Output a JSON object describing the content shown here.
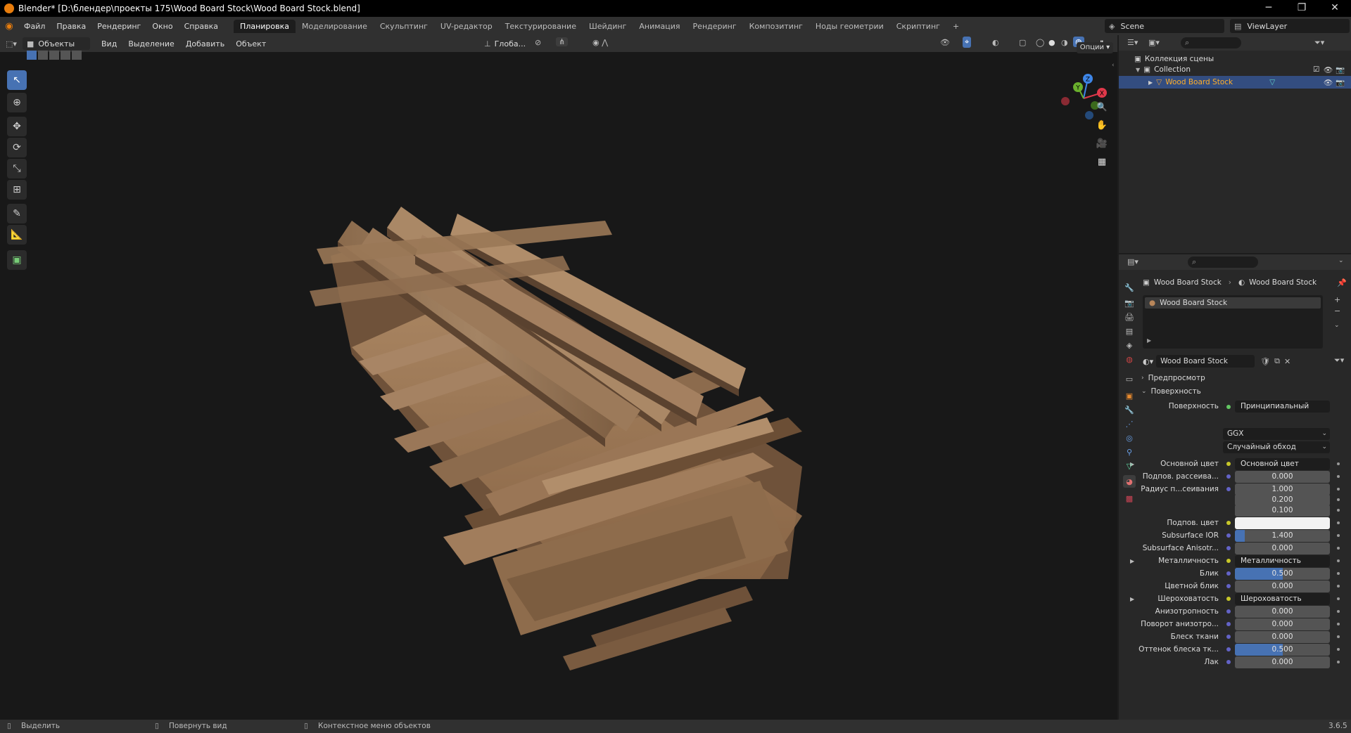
{
  "window": {
    "title": "Blender* [D:\\блендер\\проекты 175\\Wood Board Stock\\Wood Board Stock.blend]",
    "minimize": "─",
    "maximize": "❐",
    "close": "✕"
  },
  "menu": [
    "Файл",
    "Правка",
    "Рендеринг",
    "Окно",
    "Справка"
  ],
  "workspaces": [
    "Планировка",
    "Моделирование",
    "Скульптинг",
    "UV-редактор",
    "Текстурирование",
    "Шейдинг",
    "Анимация",
    "Рендеринг",
    "Композитинг",
    "Ноды геометрии",
    "Скриптинг",
    "+"
  ],
  "scene": {
    "name": "Scene",
    "view_layer": "ViewLayer"
  },
  "viewport_header": {
    "mode": "Объекты",
    "menus": [
      "Вид",
      "Выделение",
      "Добавить",
      "Объект"
    ],
    "orientation": "Глоба...",
    "options": "Опции"
  },
  "gizmo": {
    "x": "X",
    "y": "Y",
    "z": "Z"
  },
  "outliner": {
    "scene_collection": "Коллекция сцены",
    "collection": "Collection",
    "object": "Wood Board Stock"
  },
  "properties": {
    "breadcrumb_object": "Wood Board Stock",
    "breadcrumb_material": "Wood Board Stock",
    "material_slot": "Wood Board Stock",
    "material_name": "Wood Board Stock",
    "panel_preview": "Предпросмотр",
    "panel_surface": "Поверхность",
    "surface_label": "Поверхность",
    "surface_value": "Принципиальный BSDF",
    "distribution": "GGX",
    "subsurface_method": "Случайный обход",
    "rows": [
      {
        "label": "Основной цвет",
        "value": "Основной цвет",
        "kind": "link"
      },
      {
        "label": "Подпов. рассеива...",
        "value": "0.000",
        "kind": "num",
        "fill": 0
      },
      {
        "label": "Радиус п...сеивания",
        "value": "1.000",
        "kind": "num",
        "fill": 0
      },
      {
        "label": "",
        "value": "0.200",
        "kind": "num",
        "fill": 0
      },
      {
        "label": "",
        "value": "0.100",
        "kind": "num",
        "fill": 0
      },
      {
        "label": "Подпов. цвет",
        "value": "",
        "kind": "color"
      },
      {
        "label": "Subsurface IOR",
        "value": "1.400",
        "kind": "num",
        "fill": 0.1
      },
      {
        "label": "Subsurface Anisotr...",
        "value": "0.000",
        "kind": "num",
        "fill": 0
      },
      {
        "label": "Металличность",
        "value": "Металличность",
        "kind": "link"
      },
      {
        "label": "Блик",
        "value": "0.500",
        "kind": "num",
        "fill": 0.5
      },
      {
        "label": "Цветной блик",
        "value": "0.000",
        "kind": "num",
        "fill": 0
      },
      {
        "label": "Шероховатость",
        "value": "Шероховатость",
        "kind": "link"
      },
      {
        "label": "Анизотропность",
        "value": "0.000",
        "kind": "num",
        "fill": 0
      },
      {
        "label": "Поворот анизотро...",
        "value": "0.000",
        "kind": "num",
        "fill": 0
      },
      {
        "label": "Блеск ткани",
        "value": "0.000",
        "kind": "num",
        "fill": 0
      },
      {
        "label": "Оттенок блеска тк...",
        "value": "0.500",
        "kind": "num",
        "fill": 0.5
      },
      {
        "label": "Лак",
        "value": "0.000",
        "kind": "num",
        "fill": 0
      }
    ]
  },
  "status": {
    "select": "Выделить",
    "rotate": "Повернуть вид",
    "context": "Контекстное меню объектов",
    "version": "3.6.5"
  },
  "colors": {
    "accent": "#4772b3",
    "wood": "#a07a55",
    "bg": "#181818"
  }
}
